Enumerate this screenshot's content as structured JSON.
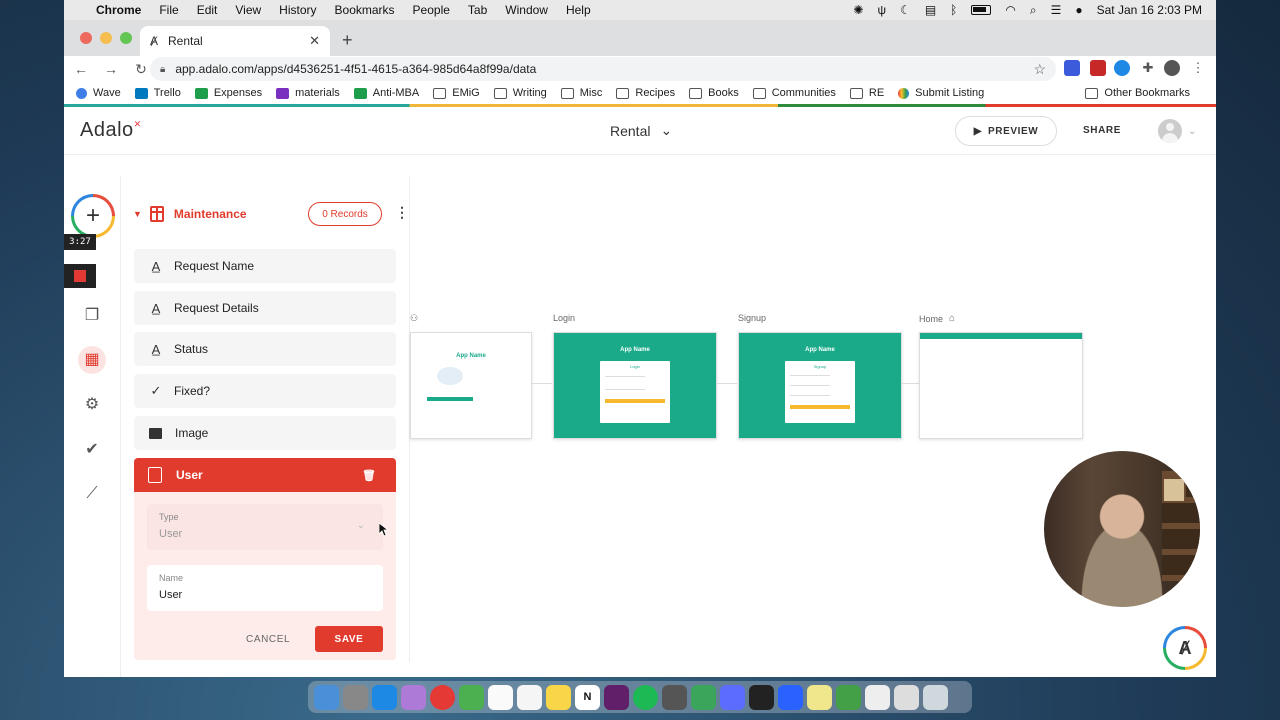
{
  "menubar": {
    "app": "Chrome",
    "items": [
      "File",
      "Edit",
      "View",
      "History",
      "Bookmarks",
      "People",
      "Tab",
      "Window",
      "Help"
    ],
    "clock": "Sat Jan 16  2:03 PM"
  },
  "browser": {
    "tab_title": "Rental",
    "url": "app.adalo.com/apps/d4536251-4f51-4615-a364-985d64a8f99a/data",
    "bookmarks": [
      "Wave",
      "Trello",
      "Expenses",
      "materials",
      "Anti-MBA",
      "EMiG",
      "Writing",
      "Misc",
      "Recipes",
      "Books",
      "Communities",
      "RE",
      "Submit Listing"
    ],
    "other_bookmarks": "Other Bookmarks"
  },
  "header": {
    "logo": "Adalo",
    "app_title": "Rental",
    "preview": "PREVIEW",
    "share": "SHARE"
  },
  "recording": {
    "timer": "3:27"
  },
  "collection": {
    "name": "Maintenance",
    "records": "0 Records",
    "properties": [
      {
        "label": "Request Name",
        "icon": "text-icon"
      },
      {
        "label": "Request Details",
        "icon": "text-icon"
      },
      {
        "label": "Status",
        "icon": "text-icon"
      },
      {
        "label": "Fixed?",
        "icon": "checkmark-icon"
      },
      {
        "label": "Image",
        "icon": "image-icon"
      }
    ],
    "relationship": {
      "label": "User",
      "type_label": "Type",
      "type_value": "User",
      "name_label": "Name",
      "name_value": "User",
      "cancel": "CANCEL",
      "save": "SAVE"
    }
  },
  "canvas": {
    "screens": [
      {
        "label": "",
        "app_name": "App Name"
      },
      {
        "label": "Login",
        "app_name": "App Name",
        "card_title": "Login"
      },
      {
        "label": "Signup",
        "app_name": "App Name",
        "card_title": "Signup"
      },
      {
        "label": "Home",
        "app_name": ""
      }
    ]
  },
  "colors": {
    "accent": "#e03b2d",
    "teal": "#1aaa8a"
  }
}
